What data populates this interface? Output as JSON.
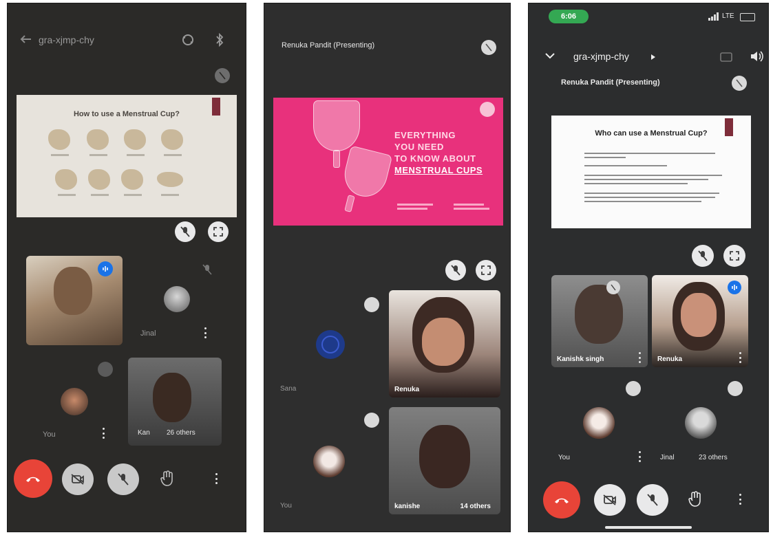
{
  "phone1": {
    "meeting_code": "gra-xjmp-chy",
    "slide_title": "How to use a Menstrual Cup?",
    "participants": [
      {
        "name": "Jinal"
      },
      {
        "name": "You"
      },
      {
        "name": "Kan",
        "extra": "26 others"
      }
    ]
  },
  "phone2": {
    "presenter": "Renuka Pandit (Presenting)",
    "slide_headline": [
      "EVERYTHING",
      "YOU NEED",
      "TO KNOW ABOUT"
    ],
    "slide_highlight": "MENSTRUAL CUPS",
    "participants": [
      {
        "name": "Sana"
      },
      {
        "name": "Renuka"
      },
      {
        "name": "You"
      },
      {
        "name": "kanishe",
        "extra": "14 others"
      }
    ]
  },
  "phone3": {
    "status_time": "6:06",
    "network": "LTE",
    "meeting_code": "gra-xjmp-chy",
    "presenter": "Renuka Pandit (Presenting)",
    "slide_title": "Who can use a Menstrual Cup?",
    "participants": [
      {
        "name": "Kanishk singh"
      },
      {
        "name": "Renuka"
      },
      {
        "name": "You"
      },
      {
        "name": "Jinal",
        "extra": "23 others"
      }
    ]
  },
  "colors": {
    "end_call": "#e84438",
    "status_green": "#34a853",
    "slide_pink": "#e8317c",
    "speaking_blue": "#1a73e8"
  },
  "icons": [
    "back-arrow-icon",
    "switch-camera-icon",
    "bluetooth-icon",
    "mic-off-icon",
    "fullscreen-icon",
    "end-call-icon",
    "camera-off-icon",
    "raise-hand-icon",
    "more-vert-icon",
    "speaker-icon",
    "chevron-right-icon"
  ]
}
